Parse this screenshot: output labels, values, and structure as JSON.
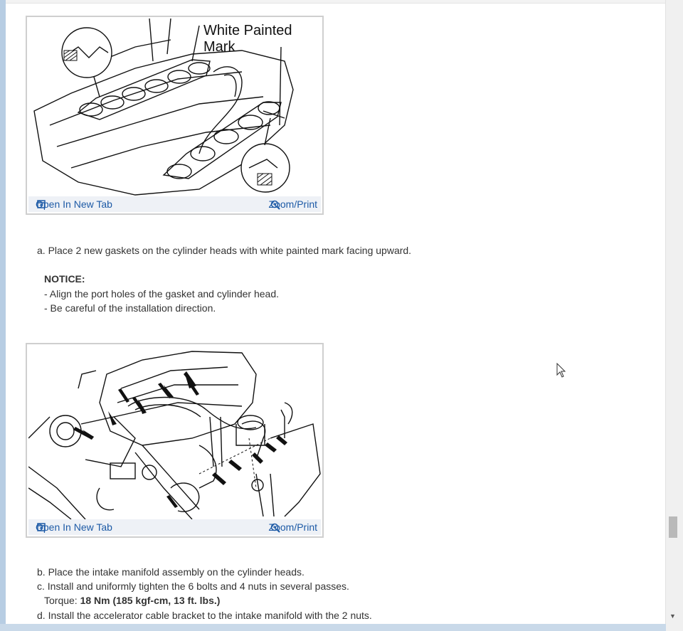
{
  "figure1": {
    "label": "White Painted\nMark",
    "label_line1": "White Painted",
    "label_line2": "Mark",
    "open_label": "Open In New Tab",
    "zoom_label": "Zoom/Print"
  },
  "step_a": "a. Place 2 new gaskets on the cylinder heads with white painted mark facing upward.",
  "notice": {
    "title": "NOTICE:",
    "items": [
      "-  Align the port holes of the gasket and cylinder head.",
      "-  Be careful of the installation direction."
    ]
  },
  "figure2": {
    "open_label": "Open In New Tab",
    "zoom_label": "Zoom/Print"
  },
  "step_b": "b. Place the intake manifold assembly on the cylinder heads.",
  "step_c": "c. Install and uniformly tighten the 6 bolts and 4 nuts in several passes.",
  "torque": {
    "label": "Torque: ",
    "value": "18 Nm (185 kgf-cm, 13 ft. lbs.)"
  },
  "step_d": "d. Install the accelerator cable bracket to the intake manifold with the 2 nuts.",
  "icons": {
    "open": "open-new-tab-icon",
    "zoom": "zoom-icon",
    "scroll_down": "scroll-down-arrow-icon",
    "cursor": "mouse-pointer-icon"
  }
}
